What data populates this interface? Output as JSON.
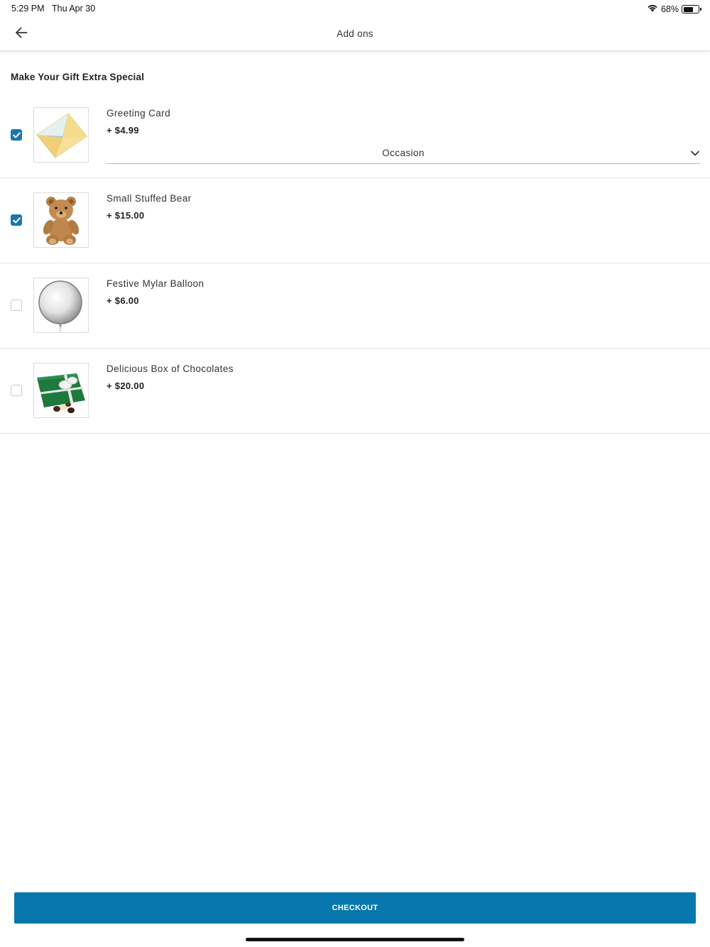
{
  "status_bar": {
    "time": "5:29 PM",
    "date": "Thu Apr 30",
    "battery": "68%",
    "battery_level": 0.68
  },
  "header": {
    "title": "Add ons",
    "back_icon": "arrow-left-icon"
  },
  "section": {
    "title": "Make Your Gift Extra Special"
  },
  "addons": [
    {
      "name": "Greeting Card",
      "price": "+ $4.99",
      "checked": true,
      "image": "envelope-card-image",
      "select_label": "Occasion"
    },
    {
      "name": "Small Stuffed Bear",
      "price": "+ $15.00",
      "checked": true,
      "image": "teddy-bear-image"
    },
    {
      "name": "Festive Mylar Balloon",
      "price": "+ $6.00",
      "checked": false,
      "image": "silver-balloon-image"
    },
    {
      "name": "Delicious Box of Chocolates",
      "price": "+ $20.00",
      "checked": false,
      "image": "chocolate-box-image"
    }
  ],
  "checkout": {
    "label": "CHECKOUT"
  },
  "colors": {
    "accent": "#1a76ad",
    "checkout_bg": "#0877ad",
    "divider": "#e4e4e4"
  }
}
